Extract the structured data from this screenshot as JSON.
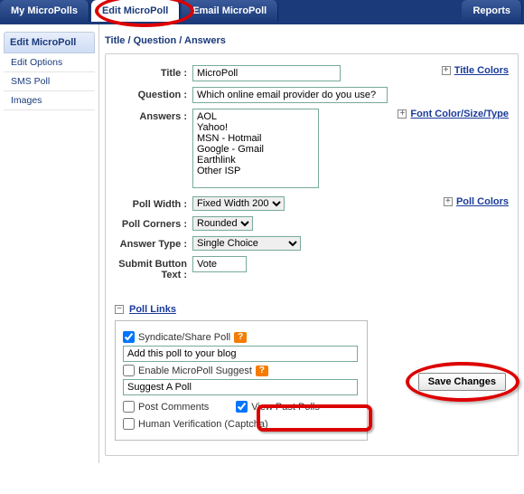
{
  "tabs": {
    "t0": "My MicroPolls",
    "t1": "Edit MicroPoll",
    "t2": "Email MicroPoll",
    "t3": "Reports"
  },
  "sidebar": {
    "heading": "Edit MicroPoll",
    "i0": "Edit Options",
    "i1": "SMS Poll",
    "i2": "Images"
  },
  "section_title": "Title / Question / Answers",
  "form": {
    "title_lbl": "Title :",
    "title_val": "MicroPoll",
    "question_lbl": "Question :",
    "question_val": "Which online email provider do you use?",
    "answers_lbl": "Answers :",
    "answers_val": "AOL\nYahoo!\nMSN - Hotmail\nGoogle - Gmail\nEarthlink\nOther ISP",
    "width_lbl": "Poll Width :",
    "width_val": "Fixed Width 200",
    "corners_lbl": "Poll Corners :",
    "corners_val": "Rounded",
    "atype_lbl": "Answer Type :",
    "atype_val": "Single Choice",
    "submit_lbl": "Submit Button Text :",
    "submit_val": "Vote"
  },
  "rightlinks": {
    "title_colors": "Title Colors",
    "font": "Font Color/Size/Type",
    "poll_colors": "Poll Colors"
  },
  "polllinks": {
    "heading": "Poll Links",
    "syndicate": "Syndicate/Share Poll",
    "addblog": "Add this poll to your blog",
    "enable_suggest": "Enable MicroPoll Suggest",
    "suggest_val": "Suggest A Poll",
    "post_comments": "Post Comments",
    "view_past": "View Past Polls",
    "captcha": "Human Verification (Captcha)"
  },
  "buttons": {
    "save": "Save Changes"
  },
  "icons": {
    "plus": "+",
    "minus": "−",
    "help": "?"
  }
}
